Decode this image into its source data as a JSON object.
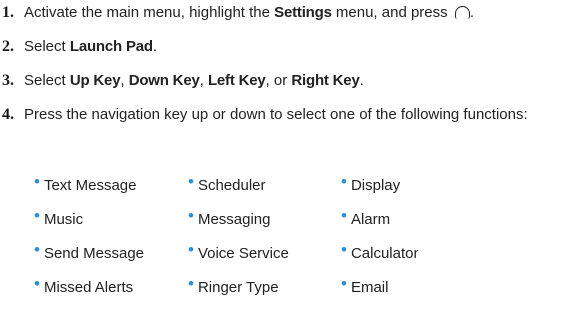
{
  "steps": [
    {
      "number": "1.",
      "parts": [
        "Activate the main menu, highlight the ",
        "Settings",
        " menu, and press ",
        "."
      ]
    },
    {
      "number": "2.",
      "parts": [
        "Select ",
        "Launch Pad",
        "."
      ]
    },
    {
      "number": "3.",
      "parts": [
        "Select ",
        "Up Key",
        ", ",
        "Down Key",
        ", ",
        "Left Key",
        ", or ",
        "Right Key",
        "."
      ]
    },
    {
      "number": "4.",
      "text": "Press the navigation key up or down to select one of the following functions:"
    }
  ],
  "functions": [
    [
      "Text Message",
      "Scheduler",
      "Display"
    ],
    [
      "Music",
      "Messaging",
      "Alarm"
    ],
    [
      "Send Message",
      "Voice Service",
      "Calculator"
    ],
    [
      "Missed Alerts",
      "Ringer Type",
      "Email"
    ]
  ],
  "colors": {
    "bullet": "#2a8fd8",
    "text": "#222222"
  },
  "icons": {
    "ok_key": "ok-key-icon"
  }
}
